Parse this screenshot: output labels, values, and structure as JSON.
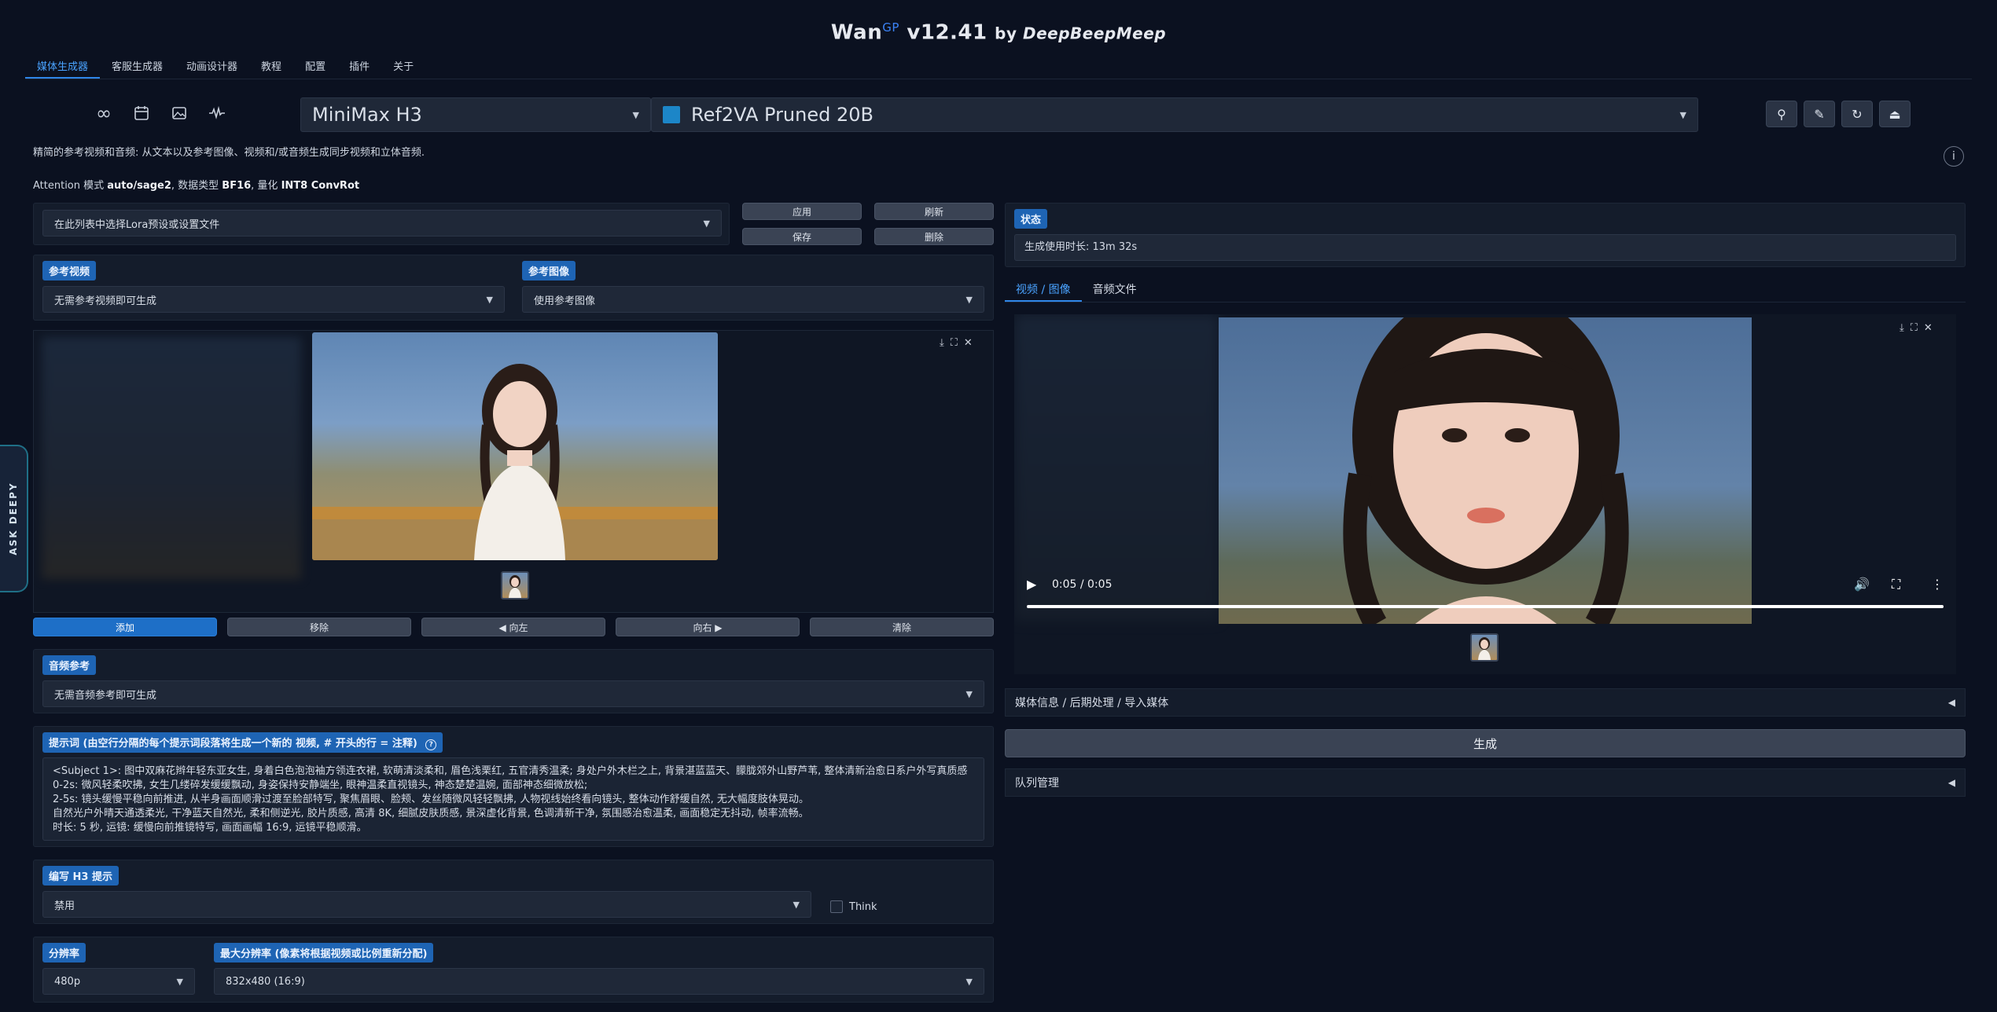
{
  "app": {
    "title_main": "Wan",
    "title_sup": "GP",
    "title_version": " v12.41 ",
    "title_by": "by ",
    "title_brand": "DeepBeepMeep"
  },
  "tabs": [
    "媒体生成器",
    "客服生成器",
    "动画设计器",
    "教程",
    "配置",
    "插件",
    "关于"
  ],
  "mode_icons": [
    "infinity-icon",
    "calendar-icon",
    "image-icon",
    "waveform-icon"
  ],
  "model": {
    "family": "MiniMax H3",
    "variant": "Ref2VA Pruned 20B",
    "variant_color": "#1c86c8"
  },
  "toolbar_icons": [
    "search-icon",
    "pencil-icon",
    "refresh-icon",
    "eject-icon"
  ],
  "description": "精简的参考视频和音频: 从文本以及参考图像、视频和/或音频生成同步视频和立体音频.",
  "attention": {
    "prefix": "Attention 模式 ",
    "mode": "auto/sage2",
    "sep1": ", 数据类型 ",
    "dtype": "BF16",
    "sep2": ", 量化 ",
    "quant": "INT8 ConvRot"
  },
  "lora": {
    "placeholder": "在此列表中选择Lora预设或设置文件",
    "buttons": [
      "应用",
      "刷新",
      "保存",
      "删除"
    ]
  },
  "ref_video": {
    "label": "参考视频",
    "value": "无需参考视频即可生成"
  },
  "ref_image": {
    "label": "参考图像",
    "value": "使用参考图像"
  },
  "gallery_buttons": [
    "添加",
    "移除",
    "◀ 向左",
    "向右 ▶",
    "清除"
  ],
  "audio_ref": {
    "label": "音频参考",
    "value": "无需音频参考即可生成"
  },
  "prompt": {
    "label": "提示词 (由空行分隔的每个提示词段落将生成一个新的 视频, # 开头的行 = 注释)",
    "text": "<Subject 1>: 图中双麻花辫年轻东亚女生, 身着白色泡泡袖方领连衣裙, 软萌清淡柔和, 眉色浅栗红, 五官清秀温柔; 身处户外木栏之上, 背景湛蓝蓝天、朦胧郊外山野芦苇, 整体清新治愈日系户外写真质感\n0-2s: 微风轻柔吹拂, 女生几缕碎发缓缓飘动, 身姿保持安静端坐, 眼神温柔直视镜头, 神态楚楚温婉, 面部神态细微放松;\n2-5s: 镜头缓慢平稳向前推进, 从半身画面顺滑过渡至脸部特写, 聚焦眉眼、脸颊、发丝随微风轻轻飘拂, 人物视线始终看向镜头, 整体动作舒缓自然, 无大幅度肢体晃动。\n自然光户外晴天通透柔光, 干净蓝天自然光, 柔和侧逆光, 胶片质感, 高清 8K, 细腻皮肤质感, 景深虚化背景, 色调清新干净, 氛围感治愈温柔, 画面稳定无抖动, 帧率流畅。\n时长: 5 秒, 运镜: 缓慢向前推镜特写, 画面画幅 16:9, 运镜平稳顺滑。"
  },
  "h3_prompt": {
    "label": "编写 H3 提示",
    "value": "禁用",
    "think_label": "Think"
  },
  "resolution": {
    "label": "分辨率",
    "value": "480p"
  },
  "max_resolution": {
    "label": "最大分辨率 (像素将根据视频或比例重新分配)",
    "value": "832x480 (16:9)"
  },
  "status": {
    "label": "状态",
    "text": "生成使用时长: 13m 32s"
  },
  "output_tabs": [
    "视频 / 图像",
    "音频文件"
  ],
  "player": {
    "time": "0:05 / 0:05",
    "progress": 1.0
  },
  "media_info": "媒体信息 / 后期处理 / 导入媒体",
  "generate_label": "生成",
  "queue_label": "队列管理",
  "ask_deepy": "ASK DEEPY",
  "colors": {
    "accent": "#1e6fc7",
    "background": "#0b1120",
    "panel": "#141c2b"
  }
}
